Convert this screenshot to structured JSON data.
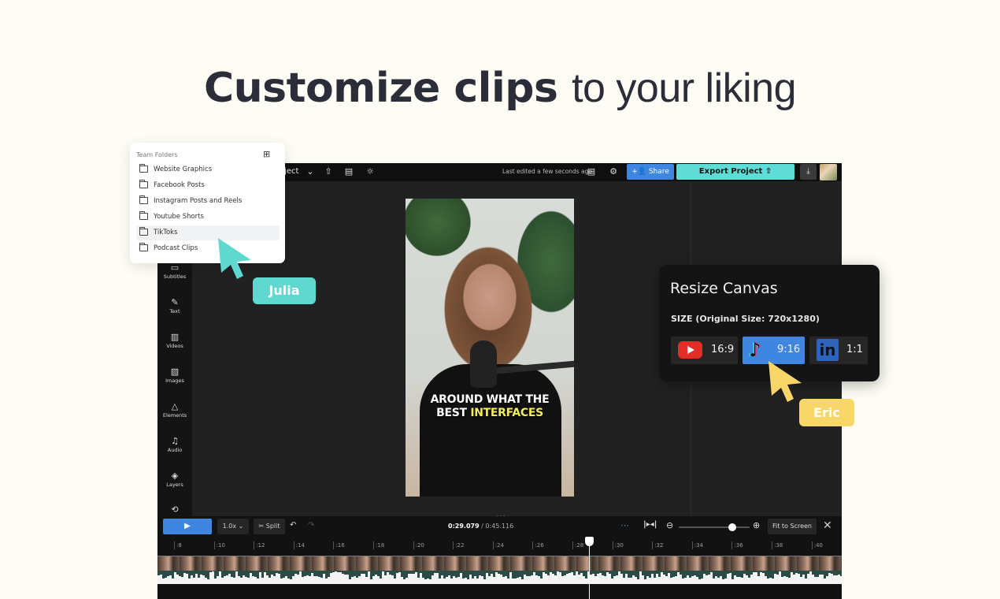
{
  "headline": {
    "bold": "Customize clips",
    "light": "to your liking"
  },
  "topbar": {
    "project_label": "oject",
    "last_edited": "Last edited a few seconds ago",
    "share_label": "Share",
    "export_label": "Export Project",
    "icons": [
      "chevron-down-icon",
      "upload-icon",
      "subtitles-icon",
      "lightbulb-icon",
      "comment-icon",
      "gear-icon",
      "download-icon"
    ]
  },
  "sidebar": {
    "items": [
      {
        "label": "Subtitles",
        "icon": "subtitles-icon"
      },
      {
        "label": "Text",
        "icon": "pencil-icon"
      },
      {
        "label": "Videos",
        "icon": "film-icon"
      },
      {
        "label": "Images",
        "icon": "image-icon"
      },
      {
        "label": "Elements",
        "icon": "shapes-icon"
      },
      {
        "label": "Audio",
        "icon": "music-icon"
      },
      {
        "label": "Layers",
        "icon": "layers-icon"
      },
      {
        "label": "",
        "icon": "loop-icon"
      }
    ]
  },
  "video": {
    "caption_line1": "AROUND WHAT THE",
    "caption_line2_white": "BEST",
    "caption_line2_highlight": "INTERFACES",
    "highlight_color": "#f3ec5b"
  },
  "folders": {
    "header": "Team Folders",
    "items": [
      {
        "label": "Website Graphics",
        "selected": false
      },
      {
        "label": "Facebook Posts",
        "selected": false
      },
      {
        "label": "Instagram Posts and Reels",
        "selected": false
      },
      {
        "label": "Youtube Shorts",
        "selected": false
      },
      {
        "label": "TikToks",
        "selected": true
      },
      {
        "label": "Podcast Clips",
        "selected": false
      }
    ]
  },
  "cursors": {
    "julia": {
      "name": "Julia",
      "color": "#5fd9d0"
    },
    "eric": {
      "name": "Eric",
      "color": "#f8d768"
    }
  },
  "resize": {
    "title": "Resize Canvas",
    "subtitle": "SIZE (Original Size: 720x1280)",
    "options": [
      {
        "platform": "YouTube",
        "ratio": "16:9",
        "selected": false
      },
      {
        "platform": "TikTok",
        "ratio": "9:16",
        "selected": true
      },
      {
        "platform": "LinkedIn",
        "ratio": "1:1",
        "selected": false
      }
    ]
  },
  "timeline": {
    "speed": "1.0x",
    "split_label": "Split",
    "current_time": "0:29.079",
    "total_time": "0:45.116",
    "fit_label": "Fit to Screen",
    "zoom_level": 0.75,
    "ticks": [
      ":8",
      ":10",
      ":12",
      ":14",
      ":16",
      ":18",
      ":20",
      ":22",
      ":24",
      ":26",
      ":28",
      ":30",
      ":32",
      ":34",
      ":36",
      ":38",
      ":40"
    ]
  },
  "colors": {
    "accent_blue": "#3e86e0",
    "export_teal": "#5edcd5"
  }
}
